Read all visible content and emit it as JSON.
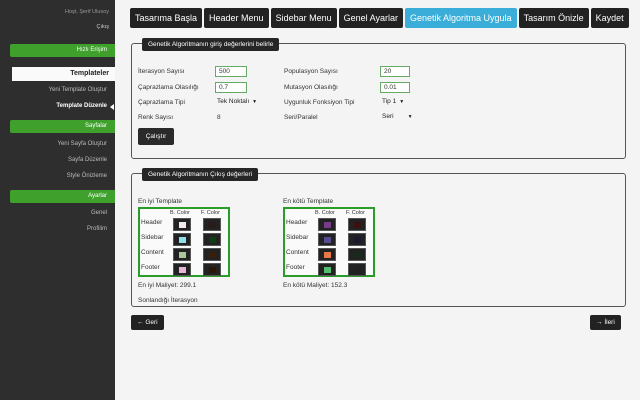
{
  "sidebar": {
    "user_line": "Hoşt, Şerif Ulusoy",
    "logout": "Çıkış",
    "quick_access": "Hızlı Erişim",
    "templates_header": "Templateler",
    "new_template": "Yeni Template Oluştur",
    "edit_template": "Template Düzenle",
    "pages_header": "Sayfalar",
    "new_page": "Yeni Sayfa Oluştur",
    "edit_page": "Sayfa Düzenle",
    "style_preview": "Style Önizleme",
    "settings_header": "Ayarlar",
    "general": "Genel",
    "profile": "Profilim"
  },
  "nav": {
    "tabs": [
      {
        "label": "Tasarıma Başla",
        "active": false
      },
      {
        "label": "Header Menu",
        "active": false
      },
      {
        "label": "Sidebar Menu",
        "active": false
      },
      {
        "label": "Genel Ayarlar",
        "active": false
      },
      {
        "label": "Genetik Algoritma Uygula",
        "active": true
      },
      {
        "label": "Tasarım Önizle",
        "active": false
      },
      {
        "label": "Kaydet",
        "active": false
      }
    ]
  },
  "inputs_panel": {
    "title": "Genetik Algoritmanın giriş değerlerini belirle",
    "iteration_label": "İterasyon Sayısı",
    "iteration_value": "500",
    "crossover_prob_label": "Çaprazlama Olasılığı",
    "crossover_prob_value": "0.7",
    "crossover_type_label": "Çaprazlama Tipi",
    "crossover_type_value": "Tek Noktalı",
    "color_count_label": "Renk Sayısı",
    "color_count_value": "8",
    "population_label": "Populasyon Sayısı",
    "population_value": "20",
    "mutation_label": "Mutasyon Olasılığı",
    "mutation_value": "0.01",
    "fitness_type_label": "Uygunluk Fonksiyon Tipi",
    "fitness_type_value": "Tip 1",
    "serial_label": "Seri/Paralel",
    "serial_value": "Seri",
    "run_button": "Çalıştır"
  },
  "outputs_panel": {
    "title": "Genetik Algoritmanın Çıkış değerleri",
    "best_title": "En iyi Template",
    "worst_title": "En kötü Template",
    "col_bg": "B. Color",
    "col_fg": "F. Color",
    "rows": [
      "Header",
      "Sidebar",
      "Content",
      "Footer"
    ],
    "best_colors": {
      "bg": [
        "#f2eaf0",
        "#8fe0e8",
        "#a8c89a",
        "#e8b4d8"
      ],
      "fg": [
        "#2a1a18",
        "#123a14",
        "#3a1e0a",
        "#2a1606"
      ]
    },
    "worst_colors": {
      "bg": [
        "#7a3a8a",
        "#5a4a90",
        "#e8784a",
        "#50c070"
      ],
      "fg": [
        "#3a1010",
        "#1a1a2a",
        "#1a2a1a",
        "#202020"
      ]
    },
    "best_cost": "En iyi Maliyet: 299.1",
    "worst_cost": "En kötü Maliyet: 152.3",
    "found_iteration": "Sonlandığı İterasyon"
  },
  "footer": {
    "back": "Geri",
    "next": "İleri"
  },
  "colors": {
    "accent_green": "#3fa12c",
    "active_tab": "#3aaed8",
    "dark": "#222222"
  }
}
